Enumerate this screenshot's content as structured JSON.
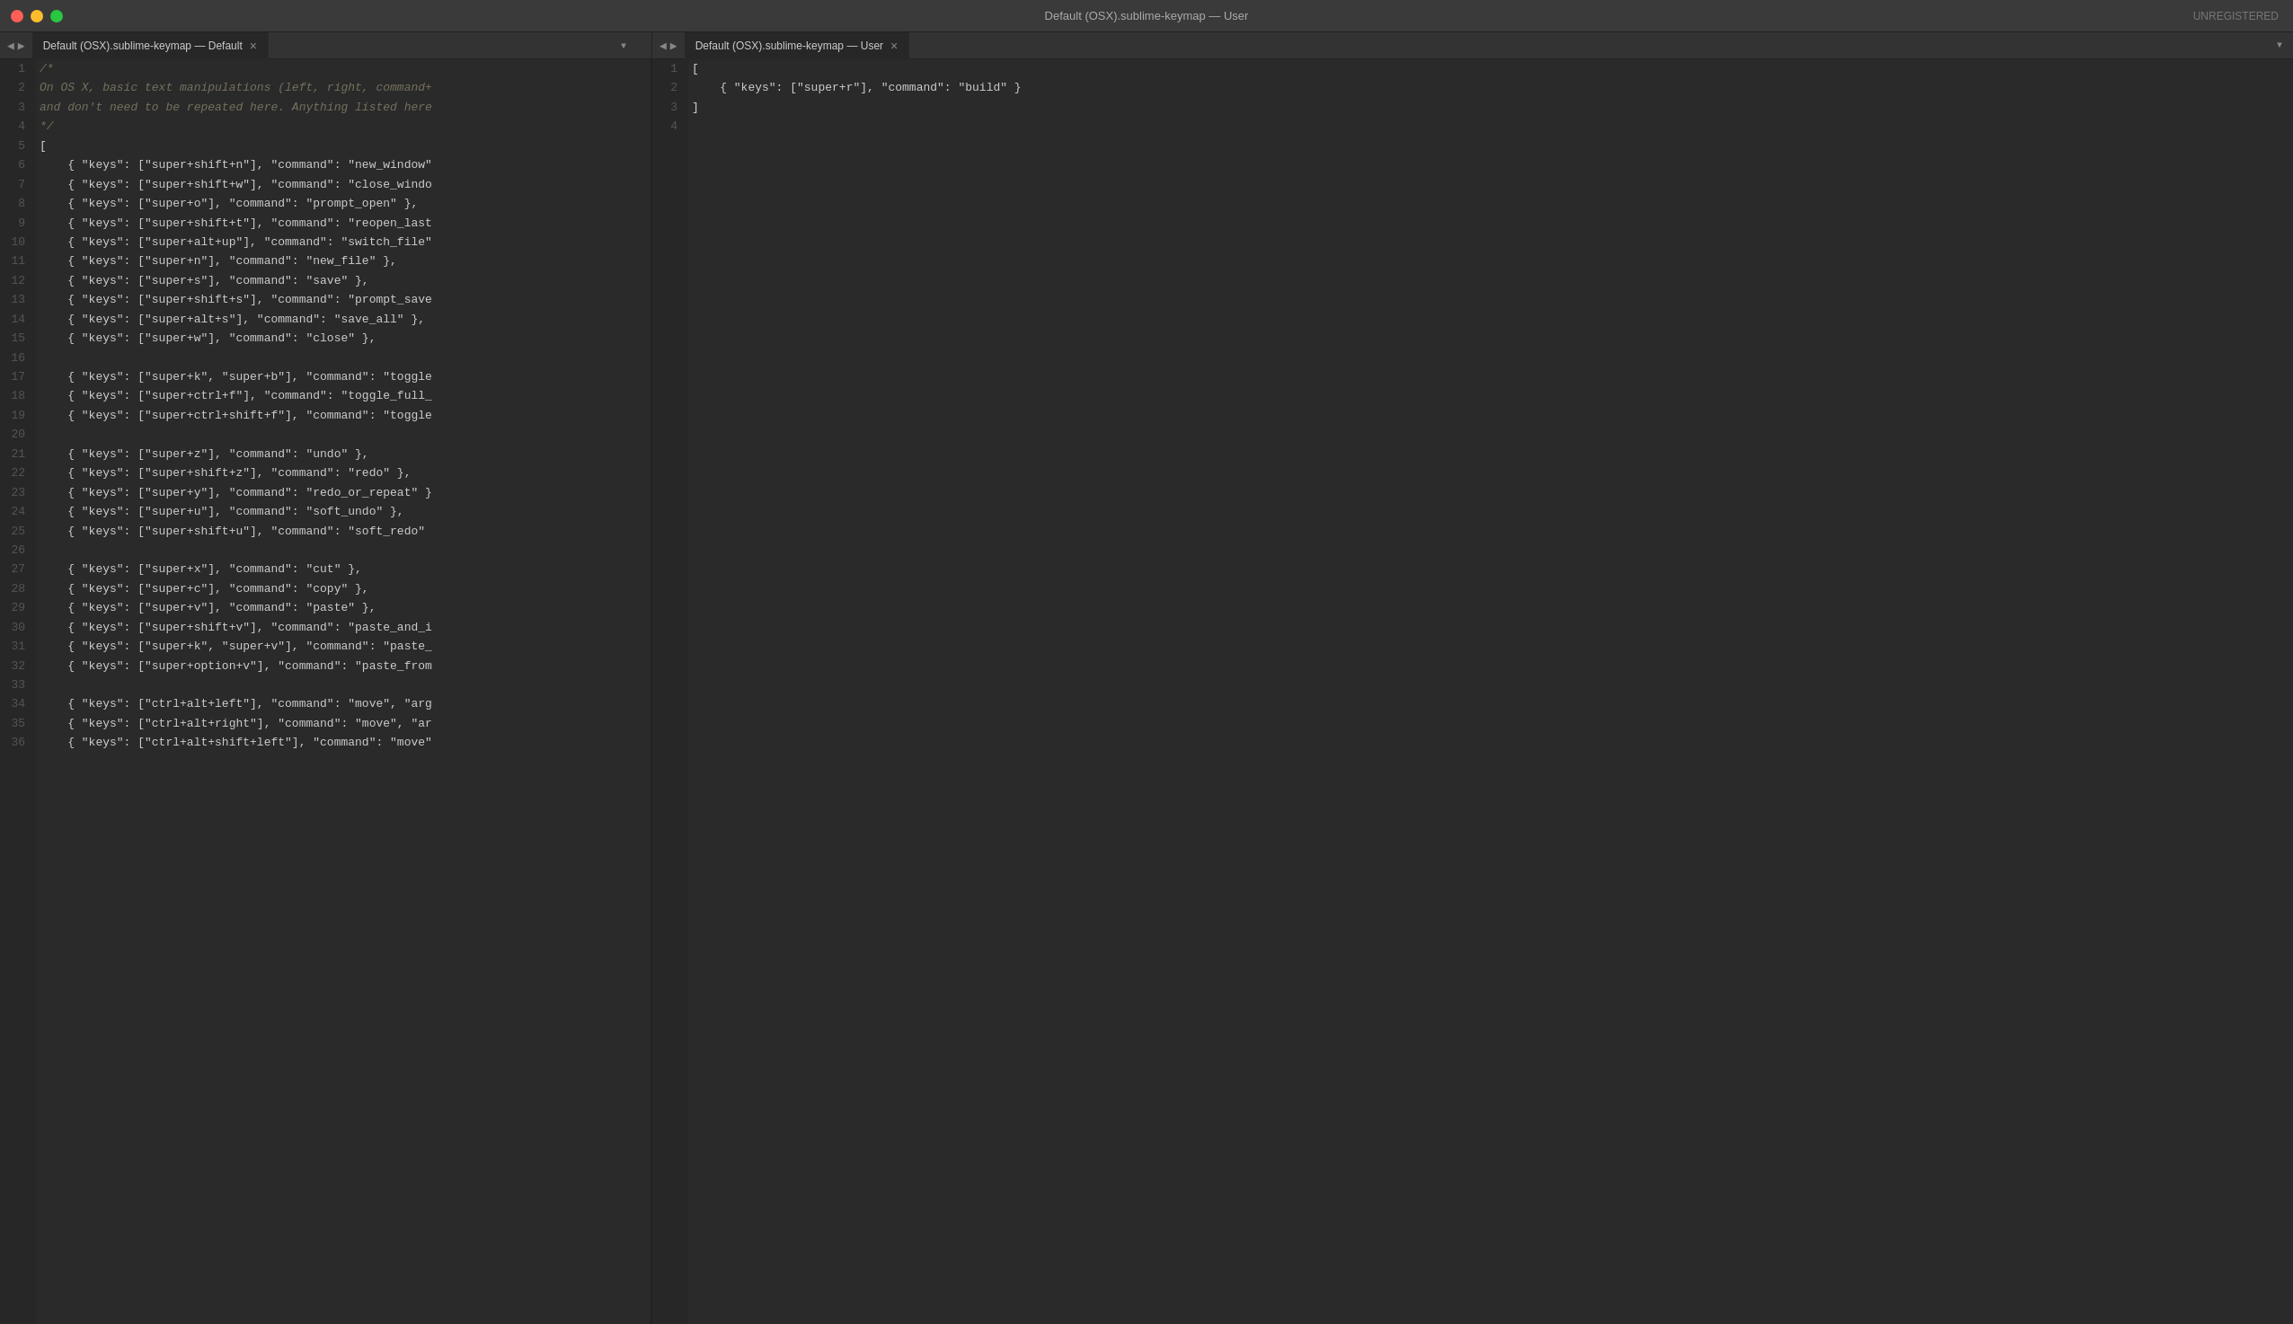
{
  "titlebar": {
    "title": "Default (OSX).sublime-keymap — User",
    "unregistered": "UNREGISTERED"
  },
  "tabs_left": {
    "label": "Default (OSX).sublime-keymap — Default",
    "close_icon": "×"
  },
  "tabs_right": {
    "label": "Default (OSX).sublime-keymap — User",
    "close_icon": "×"
  },
  "left_lines": [
    {
      "num": "1",
      "content": "/*"
    },
    {
      "num": "2",
      "content": "On OS X, basic text manipulations (left, right, command+"
    },
    {
      "num": "3",
      "content": "and don't need to be repeated here. Anything listed here"
    },
    {
      "num": "4",
      "content": "*/"
    },
    {
      "num": "5",
      "content": "["
    },
    {
      "num": "6",
      "content": "    { \"keys\": [\"super+shift+n\"], \"command\": \"new_window\""
    },
    {
      "num": "7",
      "content": "    { \"keys\": [\"super+shift+w\"], \"command\": \"close_windo"
    },
    {
      "num": "8",
      "content": "    { \"keys\": [\"super+o\"], \"command\": \"prompt_open\" },"
    },
    {
      "num": "9",
      "content": "    { \"keys\": [\"super+shift+t\"], \"command\": \"reopen_last"
    },
    {
      "num": "10",
      "content": "    { \"keys\": [\"super+alt+up\"], \"command\": \"switch_file\""
    },
    {
      "num": "11",
      "content": "    { \"keys\": [\"super+n\"], \"command\": \"new_file\" },"
    },
    {
      "num": "12",
      "content": "    { \"keys\": [\"super+s\"], \"command\": \"save\" },"
    },
    {
      "num": "13",
      "content": "    { \"keys\": [\"super+shift+s\"], \"command\": \"prompt_save"
    },
    {
      "num": "14",
      "content": "    { \"keys\": [\"super+alt+s\"], \"command\": \"save_all\" },"
    },
    {
      "num": "15",
      "content": "    { \"keys\": [\"super+w\"], \"command\": \"close\" },"
    },
    {
      "num": "16",
      "content": ""
    },
    {
      "num": "17",
      "content": "    { \"keys\": [\"super+k\", \"super+b\"], \"command\": \"toggle"
    },
    {
      "num": "18",
      "content": "    { \"keys\": [\"super+ctrl+f\"], \"command\": \"toggle_full_"
    },
    {
      "num": "19",
      "content": "    { \"keys\": [\"super+ctrl+shift+f\"], \"command\": \"toggle"
    },
    {
      "num": "20",
      "content": ""
    },
    {
      "num": "21",
      "content": "    { \"keys\": [\"super+z\"], \"command\": \"undo\" },"
    },
    {
      "num": "22",
      "content": "    { \"keys\": [\"super+shift+z\"], \"command\": \"redo\" },"
    },
    {
      "num": "23",
      "content": "    { \"keys\": [\"super+y\"], \"command\": \"redo_or_repeat\" }"
    },
    {
      "num": "24",
      "content": "    { \"keys\": [\"super+u\"], \"command\": \"soft_undo\" },"
    },
    {
      "num": "25",
      "content": "    { \"keys\": [\"super+shift+u\"], \"command\": \"soft_redo\""
    },
    {
      "num": "26",
      "content": ""
    },
    {
      "num": "27",
      "content": "    { \"keys\": [\"super+x\"], \"command\": \"cut\" },"
    },
    {
      "num": "28",
      "content": "    { \"keys\": [\"super+c\"], \"command\": \"copy\" },"
    },
    {
      "num": "29",
      "content": "    { \"keys\": [\"super+v\"], \"command\": \"paste\" },"
    },
    {
      "num": "30",
      "content": "    { \"keys\": [\"super+shift+v\"], \"command\": \"paste_and_i"
    },
    {
      "num": "31",
      "content": "    { \"keys\": [\"super+k\", \"super+v\"], \"command\": \"paste_"
    },
    {
      "num": "32",
      "content": "    { \"keys\": [\"super+option+v\"], \"command\": \"paste_from"
    },
    {
      "num": "33",
      "content": ""
    },
    {
      "num": "34",
      "content": "    { \"keys\": [\"ctrl+alt+left\"], \"command\": \"move\", \"arg"
    },
    {
      "num": "35",
      "content": "    { \"keys\": [\"ctrl+alt+right\"], \"command\": \"move\", \"ar"
    },
    {
      "num": "36",
      "content": "    { \"keys\": [\"ctrl+alt+shift+left\"], \"command\": \"move\""
    }
  ],
  "right_lines": [
    {
      "num": "1",
      "content": "["
    },
    {
      "num": "2",
      "content": "    { \"keys\": [\"super+r\"], \"command\": \"build\" }"
    },
    {
      "num": "3",
      "content": "]"
    },
    {
      "num": "4",
      "content": ""
    }
  ]
}
